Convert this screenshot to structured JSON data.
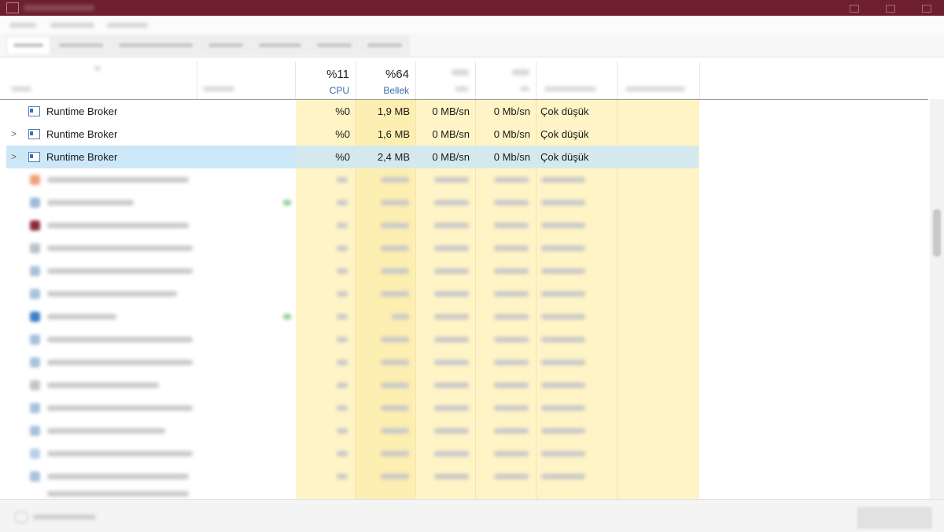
{
  "header": {
    "cpu": {
      "percent": "%11",
      "label": "CPU"
    },
    "memory": {
      "percent": "%64",
      "label": "Bellek"
    }
  },
  "rows": [
    {
      "name": "Runtime Broker",
      "expander": "",
      "cpu": "%0",
      "memory": "1,9 MB",
      "disk": "0 MB/sn",
      "network": "0 Mb/sn",
      "power": "Çok düşük"
    },
    {
      "name": "Runtime Broker",
      "expander": ">",
      "cpu": "%0",
      "memory": "1,6 MB",
      "disk": "0 MB/sn",
      "network": "0 Mb/sn",
      "power": "Çok düşük"
    },
    {
      "name": "Runtime Broker",
      "expander": ">",
      "cpu": "%0",
      "memory": "2,4 MB",
      "disk": "0 MB/sn",
      "network": "0 Mb/sn",
      "power": "Çok düşük"
    }
  ],
  "colors": {
    "titlebar": "#6e1f2e",
    "column_highlight": "#fff4c6",
    "memory_highlight": "#fdefb1",
    "selected_row": "#cce8f8",
    "header_label": "#3b69a8"
  },
  "icons": {
    "window": "app-window-icon",
    "expand": "chevron-right-icon",
    "process": "process-window-icon"
  }
}
